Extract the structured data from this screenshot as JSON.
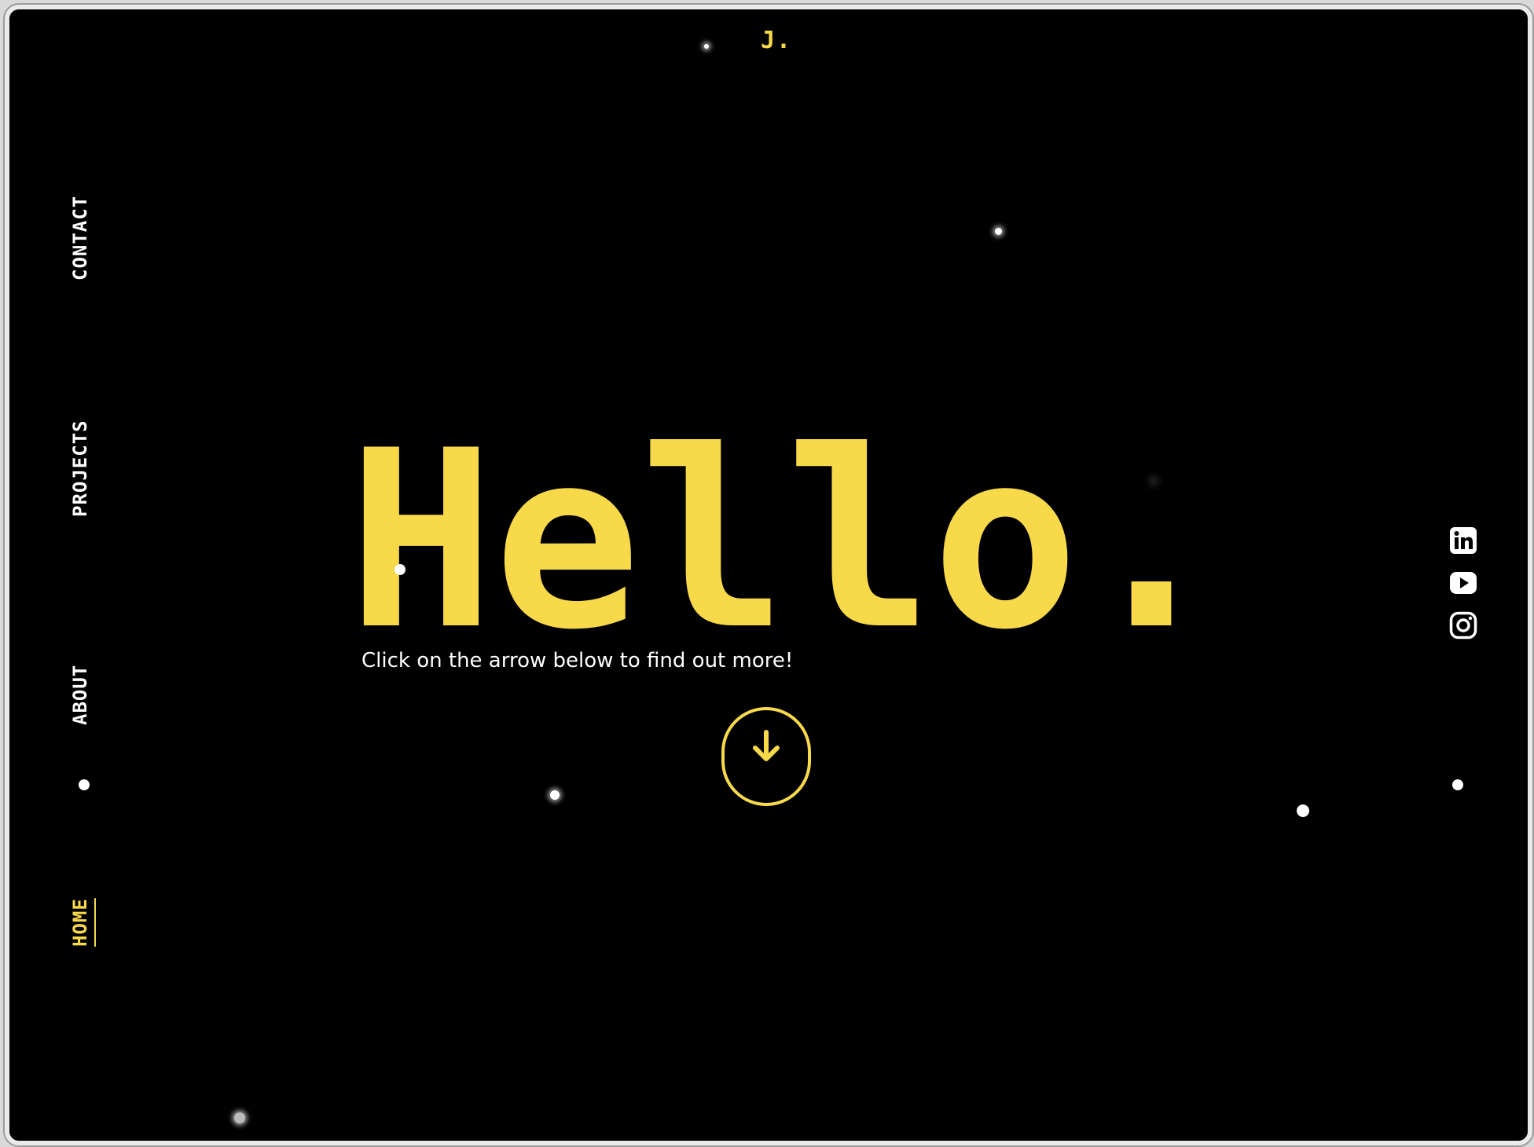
{
  "header": {
    "logo": "J."
  },
  "nav": {
    "items": [
      {
        "id": "contact",
        "label": "CONTACT",
        "active": false
      },
      {
        "id": "projects",
        "label": "PROJECTS",
        "active": false
      },
      {
        "id": "about",
        "label": "ABOUT",
        "active": false
      },
      {
        "id": "home",
        "label": "HOME",
        "active": true
      }
    ]
  },
  "hero": {
    "title": "Hello.",
    "subtitle": "Click on the arrow below to find out more!"
  },
  "scroll_button": {
    "icon": "arrow-down-icon"
  },
  "social": {
    "items": [
      {
        "id": "linkedin",
        "icon": "linkedin-icon"
      },
      {
        "id": "youtube",
        "icon": "youtube-icon"
      },
      {
        "id": "instagram",
        "icon": "instagram-icon"
      }
    ]
  },
  "colors": {
    "background": "#000000",
    "accent": "#f8d94a",
    "text": "#ffffff"
  }
}
